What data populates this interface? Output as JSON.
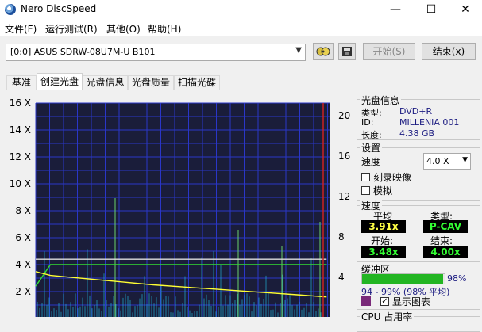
{
  "window": {
    "title": "Nero DiscSpeed",
    "minimize_glyph": "—",
    "maximize_glyph": "☐",
    "close_glyph": "✕"
  },
  "menu": [
    "文件(F)",
    "运行测试(R)",
    "其他(O)",
    "帮助(H)"
  ],
  "toolbar": {
    "drive": "[0:0]   ASUS SDRW-08U7M-U B101",
    "start_label": "开始(S)",
    "end_label": "结束(x)"
  },
  "tabs": [
    "基准",
    "创建光盘",
    "光盘信息",
    "光盘质量",
    "扫描光碟"
  ],
  "active_tab": 1,
  "disc_info": {
    "title": "光盘信息",
    "type_label": "类型:",
    "type_value": "DVD+R",
    "id_label": "ID:",
    "id_value": "MILLENIA 001",
    "length_label": "长度:",
    "length_value": "4.38 GB"
  },
  "settings": {
    "title": "设置",
    "speed_label": "速度",
    "speed_value": "4.0 X",
    "simulate_image_label": "刻录映像",
    "simulate_label": "模拟",
    "simulate_image_checked": false,
    "simulate_checked": false
  },
  "speed_panel": {
    "title": "速度",
    "avg_label": "平均",
    "avg_value": "3.91x",
    "type_label": "类型:",
    "type_value": "P-CAV",
    "start_label": "开始:",
    "start_value": "3.48x",
    "end_label": "结束:",
    "end_value": "4.00x"
  },
  "buffer": {
    "title": "缓冲区",
    "percent_text": "98%",
    "fill_fraction": 0.98,
    "range_text": "94 - 99% (98% 平均)",
    "show_chart_label": "显示图表",
    "show_chart_checked": true,
    "swatch_color": "#7a2a7a"
  },
  "cpu": {
    "title": "CPU 占用率"
  },
  "chart_data": {
    "type": "line",
    "y_left_ticks": [
      "16 X",
      "14 X",
      "12 X",
      "10 X",
      "8 X",
      "6 X",
      "4 X",
      "2 X"
    ],
    "y_right_ticks": [
      "20",
      "16",
      "12",
      "8",
      "4"
    ],
    "y_left_range": [
      0,
      16
    ],
    "y_right_range": [
      0,
      24
    ],
    "grid": true,
    "series": [
      {
        "color": "#33dd33",
        "x": [
          0.0,
          0.05,
          0.1,
          0.2,
          0.3,
          0.4,
          0.5,
          0.6,
          0.7,
          0.8,
          0.9,
          0.99
        ],
        "values": [
          2.4,
          4.0,
          4.0,
          4.0,
          4.0,
          4.0,
          4.0,
          4.0,
          4.0,
          4.0,
          4.0,
          4.0
        ]
      },
      {
        "color": "#ffff33",
        "x": [
          0.0,
          0.05,
          0.1,
          0.2,
          0.3,
          0.4,
          0.5,
          0.6,
          0.7,
          0.8,
          0.9,
          0.99
        ],
        "values": [
          3.48,
          3.2,
          3.1,
          2.9,
          2.7,
          2.5,
          2.35,
          2.2,
          2.05,
          1.9,
          1.75,
          1.6
        ]
      },
      {
        "color": "#dddddd",
        "x": [
          0.0,
          0.1,
          0.2,
          0.3,
          0.4,
          0.5,
          0.6,
          0.7,
          0.8,
          0.9,
          0.99
        ],
        "values": [
          4.4,
          4.4,
          4.4,
          4.4,
          4.4,
          4.4,
          4.4,
          4.4,
          4.4,
          4.4,
          4.4
        ]
      }
    ]
  },
  "colors": {
    "chart_bg": "#1a1d3a",
    "grid": "#2a36c8",
    "speed": "#33dd33",
    "fill": "#ffff33",
    "cpu": "#22bbdd",
    "marker": "#cc2222",
    "buffer_bar": "#22b522"
  }
}
